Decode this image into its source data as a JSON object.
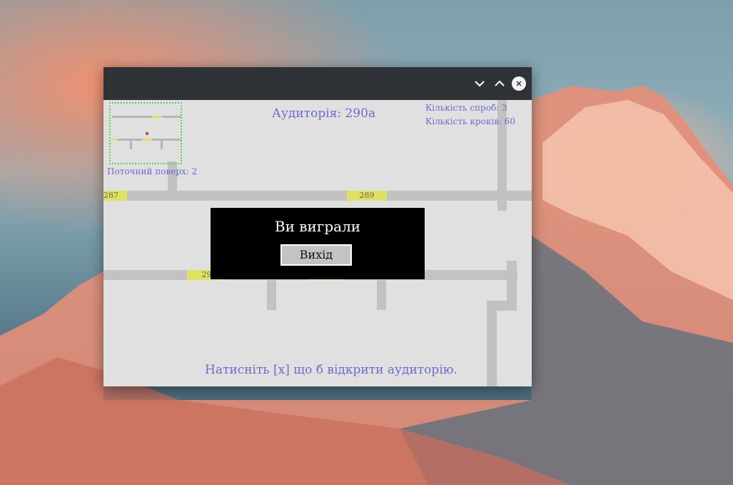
{
  "window": {
    "controls": [
      "chevron-down-icon",
      "chevron-up-icon",
      "close-icon"
    ]
  },
  "hud": {
    "room_label": "Аудиторія: 290а",
    "attempts": "Кількість спроб: 3",
    "steps": "Кількість кроків: 60",
    "floor": "Поточний поверх: 2",
    "hint": "Натисніть [x] що б відкрити аудиторію."
  },
  "doors": {
    "d287": "287",
    "d289": "289",
    "d29x": "29"
  },
  "dialog": {
    "title": "Ви виграли",
    "exit_label": "Вихід"
  },
  "colors": {
    "hud_text": "#6d6ad0",
    "wall": "#c2c2c2",
    "door": "#dfe163",
    "minimap_border": "#56d656",
    "player": "#d84a4a"
  }
}
